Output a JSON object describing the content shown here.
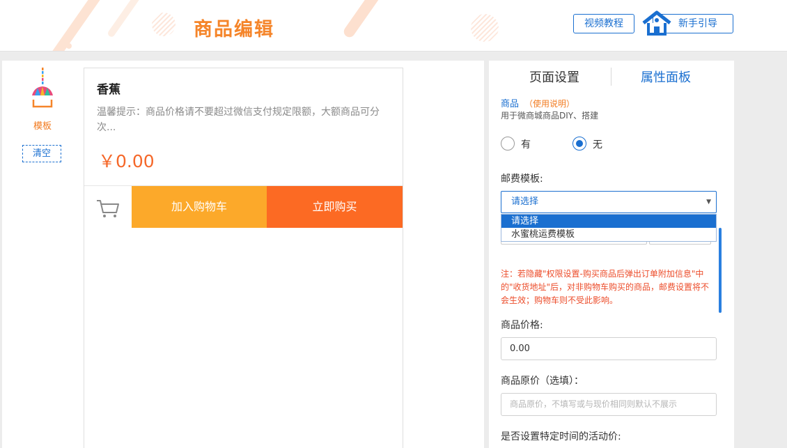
{
  "header": {
    "title": "商品编辑",
    "video_tutorial": "视频教程",
    "newbie_guide": "新手引导",
    "accent": "#f5852a",
    "brand_blue": "#1a6fd0"
  },
  "sidebar": {
    "template_label": "模板",
    "clear_label": "清空"
  },
  "product": {
    "name": "香蕉",
    "tip": "温馨提示：商品价格请不要超过微信支付规定限额，大额商品可分次...",
    "price": "￥0.00",
    "add_to_cart": "加入购物车",
    "buy_now": "立即购买",
    "add_to_cart_color": "#fca92a",
    "buy_now_color": "#fc6a23"
  },
  "panel": {
    "tabs": [
      {
        "label": "页面设置",
        "active": false
      },
      {
        "label": "属性面板",
        "active": true
      }
    ],
    "section_title": "商品",
    "usage_link": "（使用说明）",
    "section_desc": "用于微商城商品DIY、搭建",
    "radio_yes": "有",
    "radio_no": "无",
    "radio_selected": "无",
    "shipping_label": "邮费模板:",
    "shipping_select_value": "请选择",
    "shipping_options": [
      "请选择",
      "水蜜桃运费模板"
    ],
    "note": "注：若隐藏\"权限设置-购买商品后弹出订单附加信息\"中的\"收货地址\"后，对非购物车购买的商品，邮费设置将不会生效；购物车则不受此影响。",
    "price_label": "商品价格:",
    "price_value": "0.00",
    "orig_price_label": "商品原价（选填）：",
    "orig_price_placeholder": "商品原价，不填写或与现价相同则默认不展示",
    "activity_label": "是否设置特定时间的活动价:"
  }
}
